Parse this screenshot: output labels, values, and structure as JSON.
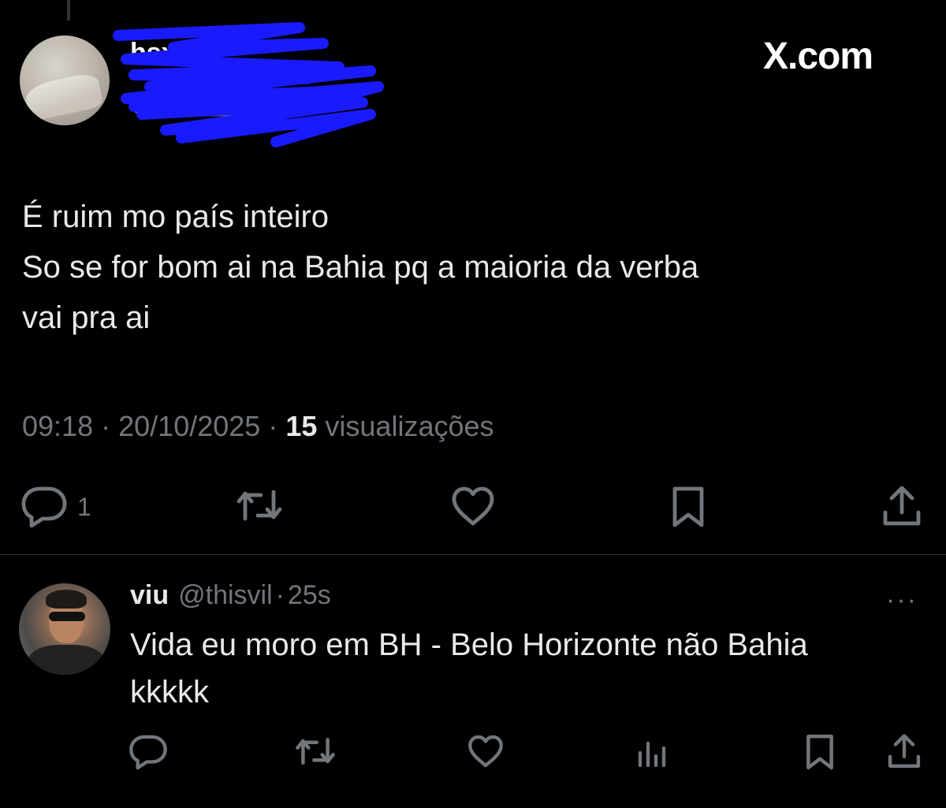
{
  "brand": {
    "watermark": "X.com"
  },
  "tweet": {
    "text": "É ruim mo país inteiro\nSo se for bom ai na Bahia pq a maioria da verba\nvai pra ai",
    "time": "09:18",
    "separator": "·",
    "date": "20/10/2025",
    "views_count": "15",
    "views_label": "visualizações",
    "replies": "1"
  },
  "reply": {
    "name": "viu",
    "handle": "@thisvil",
    "separator": "·",
    "age": "25s",
    "text": "Vida eu moro em BH - Belo Horizonte não Bahia\nkkkkk",
    "more": "···"
  },
  "colors": {
    "background": "#000000",
    "text": "#e7e9ea",
    "muted": "#71767b",
    "divider": "#2f3336",
    "redaction": "#1a1aff"
  },
  "icons": [
    "reply-icon",
    "retweet-icon",
    "like-icon",
    "bookmark-icon",
    "share-icon",
    "views-icon",
    "more-icon"
  ]
}
